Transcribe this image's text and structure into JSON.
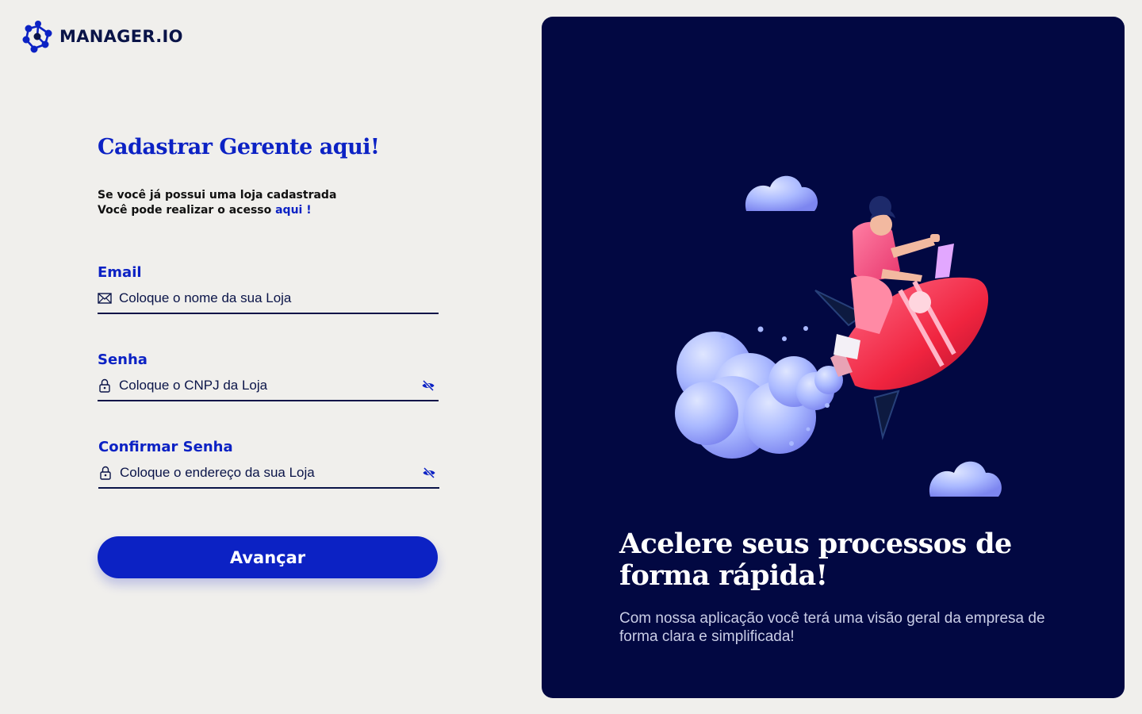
{
  "brand": {
    "name": "MANAGER.IO",
    "primary": "#0c22c4",
    "dark": "#020842",
    "background": "#f0efec"
  },
  "form": {
    "title": "Cadastrar Gerente aqui!",
    "note_line1": "Se você já possui uma loja cadastrada",
    "note_line2": "Você pode realizar o acesso ",
    "note_link": "aqui !",
    "fields": [
      {
        "label": "Email",
        "placeholder": "Coloque o nome da sua Loja",
        "icon": "envelope-icon"
      },
      {
        "label": "Senha",
        "placeholder": "Coloque o CNPJ da Loja",
        "icon": "lock-icon",
        "toggle": "eye-slash-icon"
      },
      {
        "label": "Confirmar Senha",
        "placeholder": "Coloque o endereço da sua Loja",
        "icon": "lock-icon",
        "toggle": "eye-slash-icon"
      }
    ],
    "submit_label": "Avançar"
  },
  "panel": {
    "heading": "Acelere seus processos de forma rápida!",
    "subtext": "Com nossa aplicação você terá uma visão geral da empresa de forma clara e simplificada!",
    "illustration": "woman-riding-rocket-illustration"
  }
}
